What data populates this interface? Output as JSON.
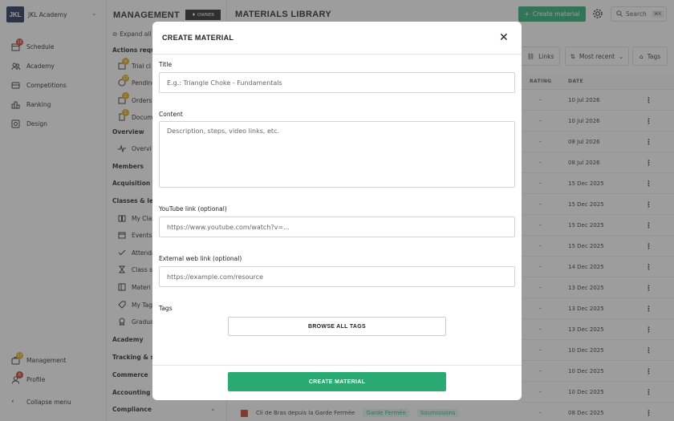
{
  "app": {
    "logo_text": "JKL",
    "academy_name": "JKL Academy"
  },
  "sidebar": {
    "items": [
      {
        "label": "Schedule",
        "badge": "10"
      },
      {
        "label": "Academy",
        "badge": ""
      },
      {
        "label": "Competitions",
        "badge": ""
      },
      {
        "label": "Ranking",
        "badge": ""
      },
      {
        "label": "Design",
        "badge": ""
      }
    ],
    "bottom": [
      {
        "label": "Management",
        "badge": "17"
      },
      {
        "label": "Profile",
        "badge": "6"
      }
    ],
    "collapse_label": "Collapse menu"
  },
  "management": {
    "title": "MANAGEMENT",
    "role_badge": "OWNER",
    "expand_all": "Expand all",
    "actions_heading": "Actions requir",
    "actions": [
      {
        "label": "Trial cl",
        "badge": "4"
      },
      {
        "label": "Pending",
        "badge": "17"
      },
      {
        "label": "Orders",
        "badge": "2"
      },
      {
        "label": "Docume",
        "badge": "1"
      }
    ],
    "overview_heading": "Overview",
    "overview_item": "Overvi",
    "members_heading": "Members",
    "acquisition_heading": "Acquisition",
    "classes_heading": "Classes & lear",
    "classes_items": [
      "My Clas",
      "Events",
      "Attenda",
      "Class se",
      "Materi",
      "My Tags",
      "Gradua"
    ],
    "lower_headings": [
      "Academy",
      "Tracking & sta",
      "Commerce",
      "Accounting & ",
      "Compliance"
    ]
  },
  "library": {
    "title": "MATERIALS LIBRARY",
    "create_button": "Create material",
    "search_label": "Search",
    "search_shortcut": "⌘K",
    "filters": {
      "links": "Links",
      "sort": "Most recent",
      "tags": "Tags"
    },
    "columns": {
      "rating": "RATING",
      "date": "DATE"
    },
    "rows": [
      {
        "rating": "-",
        "date": "10 Jul 2026"
      },
      {
        "rating": "-",
        "date": "10 Jul 2026"
      },
      {
        "rating": "-",
        "date": "08 Jul 2026"
      },
      {
        "rating": "-",
        "date": "08 Jul 2026"
      },
      {
        "rating": "-",
        "date": "15 Dec 2025"
      },
      {
        "rating": "-",
        "date": "15 Dec 2025"
      },
      {
        "rating": "-",
        "date": "15 Dec 2025"
      },
      {
        "rating": "-",
        "date": "15 Dec 2025"
      },
      {
        "rating": "-",
        "date": "14 Dec 2025"
      },
      {
        "rating": "-",
        "date": "13 Dec 2025"
      },
      {
        "rating": "-",
        "date": "13 Dec 2025"
      },
      {
        "rating": "-",
        "date": "13 Dec 2025"
      },
      {
        "rating": "-",
        "date": "10 Dec 2025"
      },
      {
        "rating": "-",
        "date": "10 Dec 2025"
      },
      {
        "rating": "-",
        "date": "10 Dec 2025"
      },
      {
        "rating": "-",
        "date": "08 Dec 2025"
      }
    ],
    "bottom_row": {
      "title": "Cli de Bras depuis la Garde Fermée",
      "tag1": "Garde Fermée",
      "tag2": "Soumissions"
    }
  },
  "modal": {
    "title": "CREATE MATERIAL",
    "title_label": "Title",
    "title_placeholder": "E.g.: Triangle Choke - Fundamentals",
    "content_label": "Content",
    "content_placeholder": "Description, steps, video links, etc.",
    "youtube_label": "YouTube link (optional)",
    "youtube_placeholder": "https://www.youtube.com/watch?v=...",
    "web_label": "External web link (optional)",
    "web_placeholder": "https://example.com/resource",
    "tags_label": "Tags",
    "browse_button": "BROWSE ALL TAGS",
    "submit_button": "CREATE MATERIAL"
  },
  "colors": {
    "accent": "#2aaa72",
    "logo_bg": "#1e2a55",
    "badge_red": "#c0392b",
    "badge_yellow": "#e1a61a"
  }
}
